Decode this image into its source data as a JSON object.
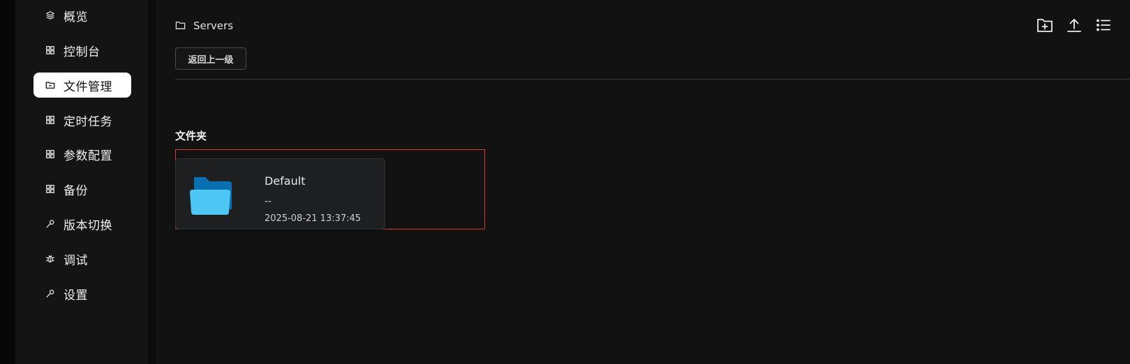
{
  "sidebar": {
    "items": [
      {
        "label": "概览",
        "icon": "layers-icon"
      },
      {
        "label": "控制台",
        "icon": "grid-icon"
      },
      {
        "label": "文件管理",
        "icon": "folder-icon",
        "active": true
      },
      {
        "label": "定时任务",
        "icon": "grid-icon"
      },
      {
        "label": "参数配置",
        "icon": "grid-icon"
      },
      {
        "label": "备份",
        "icon": "grid-icon"
      },
      {
        "label": "版本切换",
        "icon": "wrench-icon"
      },
      {
        "label": "调试",
        "icon": "bug-icon"
      },
      {
        "label": "设置",
        "icon": "wrench-icon"
      }
    ]
  },
  "breadcrumb": {
    "path": "Servers",
    "icon": "folder-outline-icon"
  },
  "toolbar": {
    "icons": [
      "new-folder-icon",
      "upload-icon",
      "list-view-icon"
    ]
  },
  "back_button": {
    "label": "返回上一级"
  },
  "folders_section": {
    "title": "文件夹"
  },
  "folders": [
    {
      "name": "Default",
      "size": "--",
      "modified": "2025-08-21 13:37:45",
      "icon": "folder-open-icon"
    }
  ],
  "colors": {
    "active_nav_bg": "#ffffff",
    "highlight_border": "#d93a3a",
    "folder_light": "#4ec7f5",
    "folder_dark": "#0a6fb0"
  }
}
